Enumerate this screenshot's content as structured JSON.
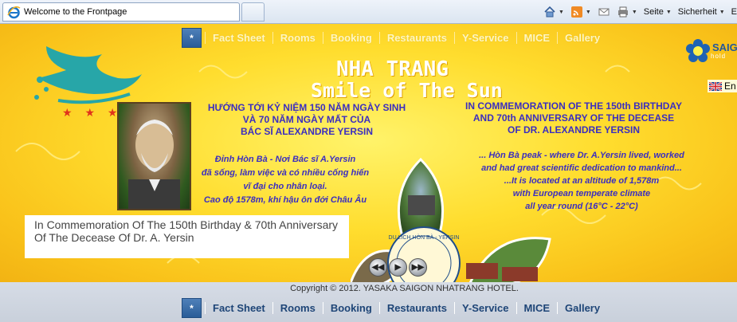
{
  "browser": {
    "tab_title": "Welcome to the Frontpage",
    "cmd": {
      "page_label": "Seite",
      "security_label": "Sicherheit",
      "extra_label": "E"
    }
  },
  "nav": {
    "home_symbol": "*",
    "items": [
      "Fact Sheet",
      "Rooms",
      "Booking",
      "Restaurants",
      "Y-Service",
      "MICE",
      "Gallery"
    ]
  },
  "logo": {
    "name": "SAIG",
    "sub": "hold"
  },
  "language": {
    "label": "En"
  },
  "stars": "★ ★ ★ ★",
  "titles": {
    "line1": "NHA TRANG",
    "line2": "Smile of The Sun"
  },
  "vn": {
    "head": [
      "HƯỚNG TỚI KỶ NIỆM 150 NĂM NGÀY SINH",
      "VÀ 70 NĂM NGÀY MẤT CỦA",
      "BÁC SĨ ALEXANDRE YERSIN"
    ],
    "body": [
      "Đỉnh Hòn Bà - Nơi Bác sĩ A.Yersin",
      "đã sống, làm việc và có nhiều cống hiến",
      "vĩ đại cho nhân loại.",
      "Cao độ 1578m, khí hậu ôn đới Châu Âu"
    ]
  },
  "en": {
    "head": [
      "IN COMMEMORATION OF THE 150th BIRTHDAY",
      "AND 70th ANNIVERSARY OF THE DECEASE",
      "OF DR. ALEXANDRE YERSIN"
    ],
    "body": [
      "... Hòn Bà peak - where Dr. A.Yersin lived, worked",
      "and had great scientific dedication to mankind...",
      "...It is located at an altitude of 1,578m",
      "with European temperate climate",
      "all year round (16°C - 22°C)"
    ]
  },
  "caption": "In Commemoration Of The 150th Birthday & 70th Anniversary Of The Decease Of Dr. A. Yersin",
  "flower_text": "DU LICH HÒN BÀ - YERSIN NATURE PRESERV",
  "copyright": "Copyright © 2012. YASAKA SAIGON NHATRANG HOTEL."
}
